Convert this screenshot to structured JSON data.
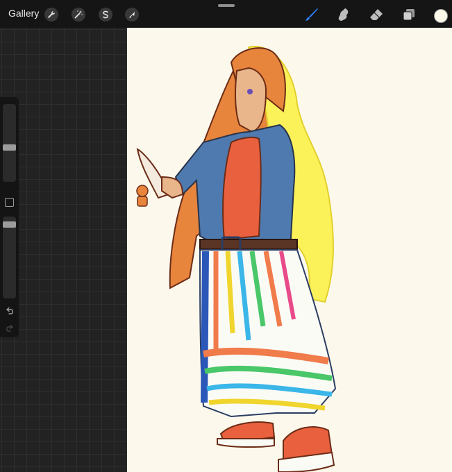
{
  "topbar": {
    "gallery_label": "Gallery",
    "actions": [
      {
        "name": "actions",
        "icon": "wrench-icon"
      },
      {
        "name": "adjustments",
        "icon": "magic-wand-icon"
      },
      {
        "name": "selection",
        "icon": "selection-s-icon"
      },
      {
        "name": "transform",
        "icon": "arrow-cursor-icon"
      }
    ],
    "tools": [
      {
        "name": "brush",
        "icon": "brush-icon",
        "active": true
      },
      {
        "name": "smudge",
        "icon": "smudge-icon",
        "active": false
      },
      {
        "name": "eraser",
        "icon": "eraser-icon",
        "active": false
      },
      {
        "name": "layers",
        "icon": "layers-icon",
        "active": false
      }
    ],
    "current_color": "#fdf9ea",
    "accent_color": "#2f7df6"
  },
  "sidebar": {
    "brush_size_level": 0.5,
    "brush_opacity_level": 0.05,
    "modify_icon": "square-icon",
    "undo_icon": "undo-icon",
    "redo_icon": "redo-icon"
  },
  "canvas": {
    "background_color": "#fcf9ec",
    "artwork": "character-illustration"
  }
}
